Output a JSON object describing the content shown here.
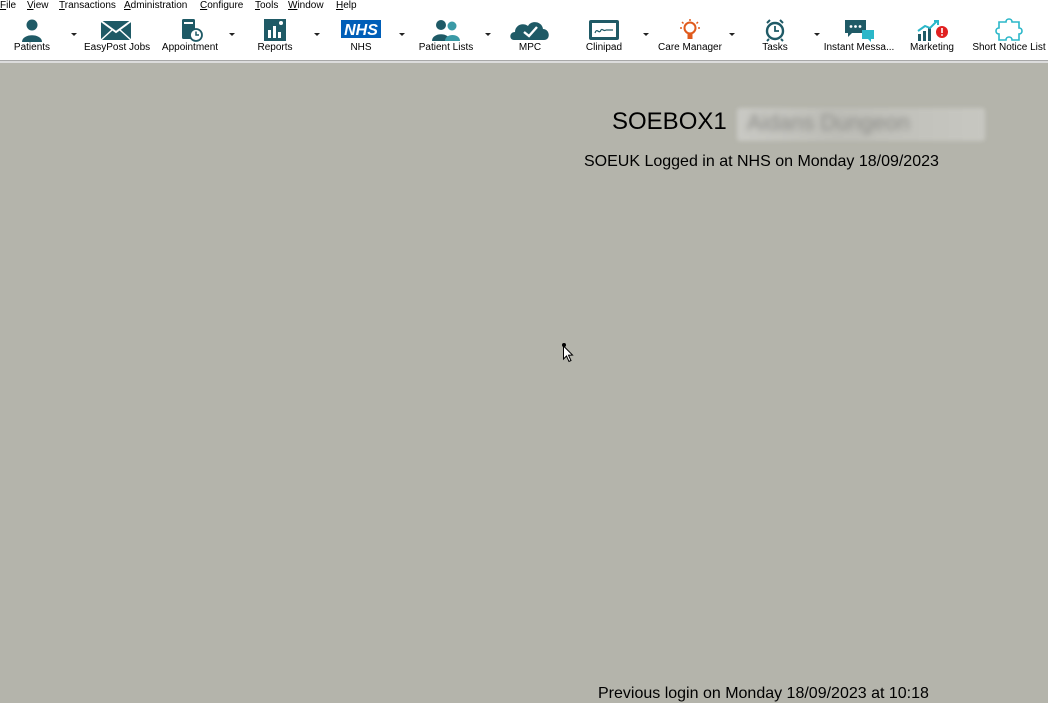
{
  "menu": [
    {
      "u": "F",
      "rest": "ile"
    },
    {
      "u": "V",
      "rest": "iew"
    },
    {
      "u": "T",
      "rest": "ransactions"
    },
    {
      "u": "A",
      "rest": "dministration"
    },
    {
      "u": "C",
      "rest": "onfigure"
    },
    {
      "u": "T",
      "rest": "ools"
    },
    {
      "u": "W",
      "rest": "indow"
    },
    {
      "u": "H",
      "rest": "elp"
    }
  ],
  "toolbar": [
    {
      "label": "Patients",
      "icon": "person-icon"
    },
    {
      "label": "EasyPost Jobs",
      "icon": "envelope-icon"
    },
    {
      "label": "Appointment",
      "icon": "appointment-book-icon"
    },
    {
      "label": "Reports",
      "icon": "bar-chart-icon"
    },
    {
      "label": "NHS",
      "icon": "nhs-logo-icon"
    },
    {
      "label": "Patient Lists",
      "icon": "people-icon"
    },
    {
      "label": "MPC",
      "icon": "cloud-check-icon"
    },
    {
      "label": "Clinipad",
      "icon": "tablet-signature-icon"
    },
    {
      "label": "Care Manager",
      "icon": "lightbulb-icon"
    },
    {
      "label": "Tasks",
      "icon": "alarm-clock-icon"
    },
    {
      "label": "Instant Messa...",
      "icon": "chat-bubbles-icon"
    },
    {
      "label": "Marketing",
      "icon": "growth-chart-alert-icon"
    },
    {
      "label": "Short Notice List",
      "icon": "puzzle-piece-icon"
    }
  ],
  "nhs_logo_text": "NHS",
  "main": {
    "computer_name": "SOEBOX1",
    "practice_name_redacted": "Aidans Dungeon",
    "login_status": "SOEUK Logged in at NHS on Monday 18/09/2023",
    "previous_login": "Previous login on Monday 18/09/2023 at 10:18"
  },
  "colors": {
    "background": "#b4b4ab",
    "icon_teal": "#1f5a66",
    "nhs_blue": "#005eb8",
    "care_manager_orange": "#e05a1c",
    "alert_red": "#e02020",
    "puzzle_cyan": "#2bb7c9"
  }
}
